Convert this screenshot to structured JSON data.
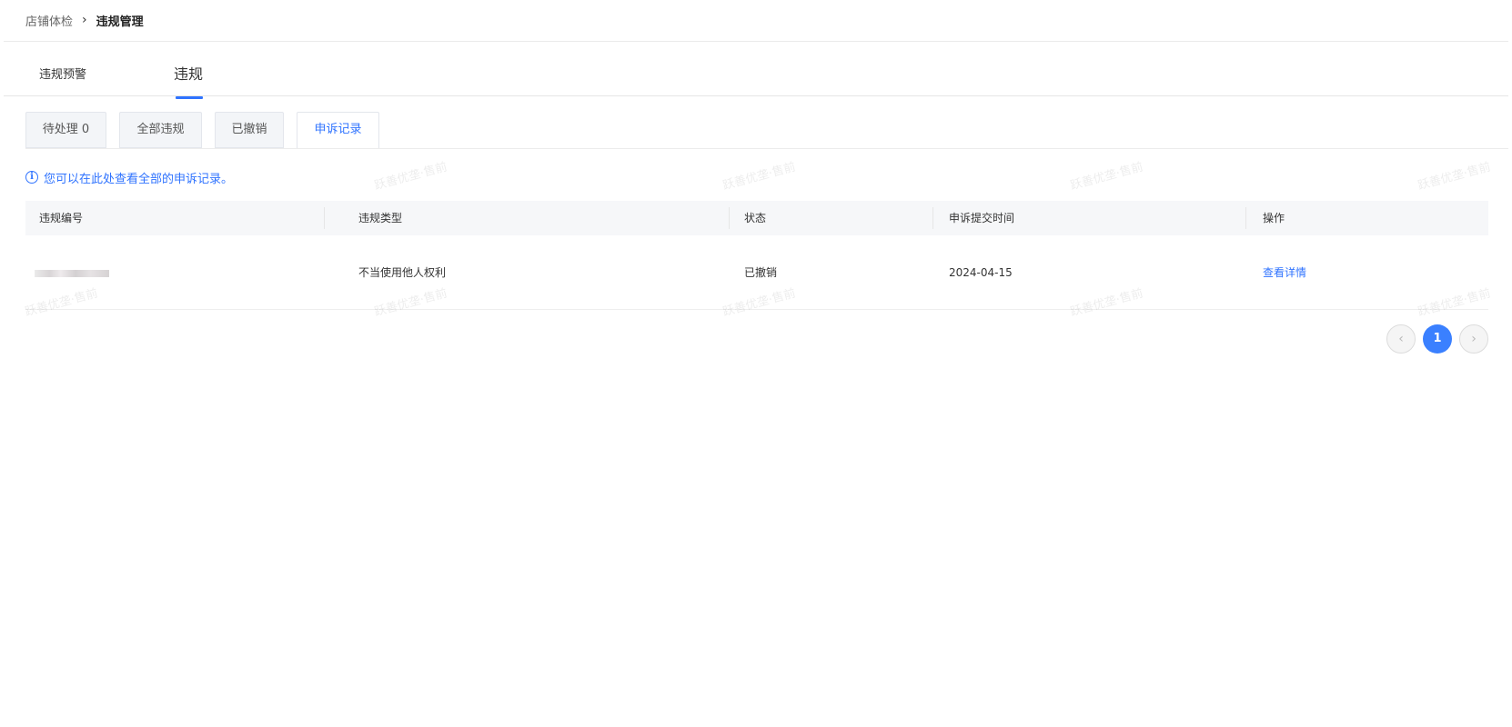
{
  "breadcrumb": {
    "parent": "店铺体检",
    "separator": "›",
    "current": "违规管理"
  },
  "main_tabs": [
    {
      "label": "违规预警",
      "active": false
    },
    {
      "label": "违规",
      "active": true
    }
  ],
  "sub_tabs": [
    {
      "label": "待处理 0",
      "active": false
    },
    {
      "label": "全部违规",
      "active": false
    },
    {
      "label": "已撤销",
      "active": false
    },
    {
      "label": "申诉记录",
      "active": true
    }
  ],
  "info": {
    "icon": "info-icon",
    "icon_glyph": "i",
    "text": "您可以在此处查看全部的申诉记录。"
  },
  "table": {
    "columns": [
      "违规编号",
      "违规类型",
      "状态",
      "申诉提交时间",
      "操作"
    ],
    "rows": [
      {
        "id_masked": true,
        "type": "不当使用他人权利",
        "status": "已撤销",
        "submit_time": "2024-04-15",
        "action": "查看详情"
      }
    ]
  },
  "pagination": {
    "prev_icon": "chevron-left-icon",
    "prev_glyph": "‹",
    "current_page": "1",
    "next_icon": "chevron-right-icon",
    "next_glyph": "›"
  },
  "watermark": {
    "text": "跃善优垄·售前"
  },
  "colors": {
    "accent": "#2f73ff",
    "page_button": "#3a80ff",
    "header_bg": "#f6f7f9"
  }
}
